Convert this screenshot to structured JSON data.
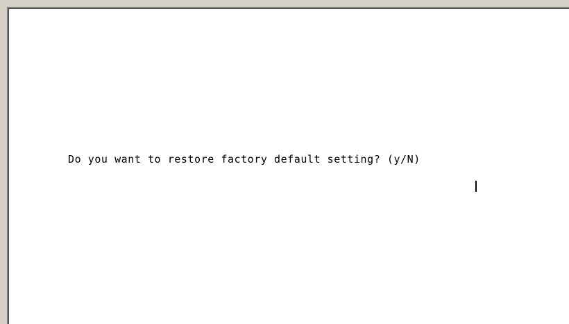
{
  "terminal": {
    "prompt_text": "Do you want to restore factory default setting? (y/N)"
  },
  "colors": {
    "frame": "#d4d0c8",
    "background": "#ffffff",
    "text": "#000000"
  }
}
